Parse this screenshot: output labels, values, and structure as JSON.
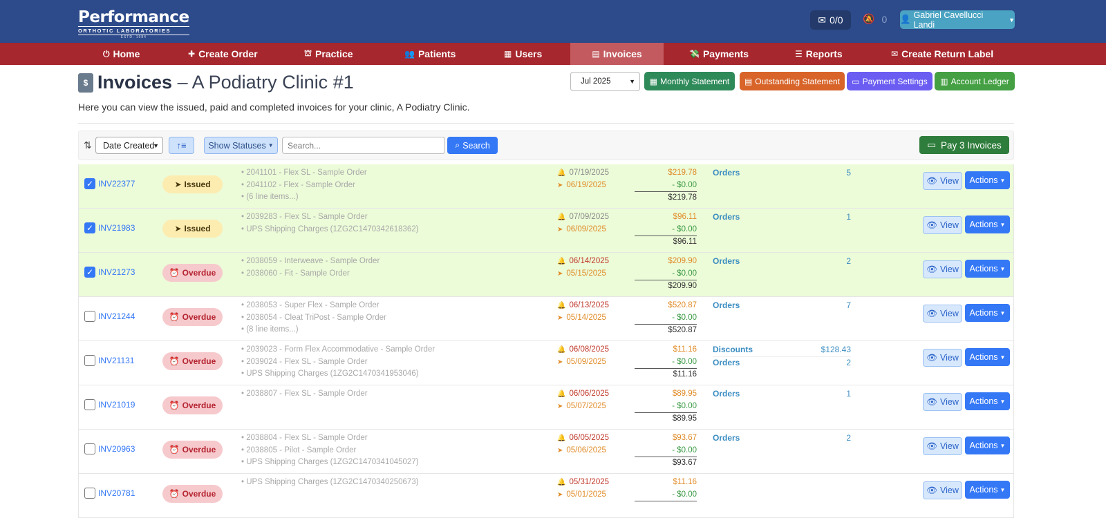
{
  "header": {
    "logo_main": "Performance",
    "logo_sub": "ORTHOTIC LABORATORIES",
    "logo_est": "ESTD. 1984",
    "messages": "0/0",
    "notifications": "0",
    "user": "Gabriel Cavellucci Landi"
  },
  "nav": [
    {
      "label": "Home",
      "icon": "⏻"
    },
    {
      "label": "Create Order",
      "icon": "✚"
    },
    {
      "label": "Practice",
      "icon": "⛫"
    },
    {
      "label": "Patients",
      "icon": "👥"
    },
    {
      "label": "Users",
      "icon": "▦"
    },
    {
      "label": "Invoices",
      "icon": "▤"
    },
    {
      "label": "Payments",
      "icon": "💸"
    },
    {
      "label": "Reports",
      "icon": "☰"
    },
    {
      "label": "Create Return Label",
      "icon": "✉"
    }
  ],
  "page": {
    "title": "Invoices",
    "subtitle": "– A Podiatry Clinic #1",
    "description": "Here you can view the issued, paid and completed invoices for your clinic, A Podiatry Clinic.",
    "month": "Jul 2025",
    "buttons": {
      "monthly": "Monthly Statement",
      "outstanding": "Outstanding Statement",
      "payment_settings": "Payment Settings",
      "ledger": "Account Ledger"
    }
  },
  "toolbar": {
    "sort_by": "Date Created",
    "show_statuses": "Show Statuses",
    "search_placeholder": "Search...",
    "search_label": "Search",
    "pay_label": "Pay 3 Invoices"
  },
  "row_labels": {
    "view": "View",
    "actions": "Actions"
  },
  "colors": {
    "primary": "#3478f6",
    "topbar": "#2d4a8a",
    "navbar": "#a6272d",
    "selected_row": "#ecfbd8"
  },
  "invoices": [
    {
      "id": "INV22377",
      "checked": true,
      "status": "Issued",
      "items": [
        "• 2041101 - Flex SL - Sample Order",
        "• 2041102 - Flex - Sample Order",
        "• (6 line items...)"
      ],
      "due": "07/19/2025",
      "sent": "06/19/2025",
      "overdue": false,
      "amount": "$219.78",
      "paid": "- $0.00",
      "balance": "$219.78",
      "cats": [
        {
          "name": "Orders",
          "value": "5"
        }
      ]
    },
    {
      "id": "INV21983",
      "checked": true,
      "status": "Issued",
      "items": [
        "• 2039283 - Flex SL - Sample Order",
        "• UPS Shipping Charges (1ZG2C1470342618362)"
      ],
      "due": "07/09/2025",
      "sent": "06/09/2025",
      "overdue": false,
      "amount": "$96.11",
      "paid": "- $0.00",
      "balance": "$96.11",
      "cats": [
        {
          "name": "Orders",
          "value": "1"
        }
      ]
    },
    {
      "id": "INV21273",
      "checked": true,
      "status": "Overdue",
      "items": [
        "• 2038059 - Interweave - Sample Order",
        "• 2038060 - Fit - Sample Order"
      ],
      "due": "06/14/2025",
      "sent": "05/15/2025",
      "overdue": true,
      "amount": "$209.90",
      "paid": "- $0.00",
      "balance": "$209.90",
      "cats": [
        {
          "name": "Orders",
          "value": "2"
        }
      ]
    },
    {
      "id": "INV21244",
      "checked": false,
      "status": "Overdue",
      "items": [
        "• 2038053 - Super Flex - Sample Order",
        "• 2038054 - Cleat TriPost - Sample Order",
        "• (8 line items...)"
      ],
      "due": "06/13/2025",
      "sent": "05/14/2025",
      "overdue": true,
      "amount": "$520.87",
      "paid": "- $0.00",
      "balance": "$520.87",
      "cats": [
        {
          "name": "Orders",
          "value": "7"
        }
      ]
    },
    {
      "id": "INV21131",
      "checked": false,
      "status": "Overdue",
      "items": [
        "• 2039023 - Form Flex Accommodative - Sample Order",
        "• 2039024 - Flex SL - Sample Order",
        "• UPS Shipping Charges (1ZG2C1470341953046)"
      ],
      "due": "06/08/2025",
      "sent": "05/09/2025",
      "overdue": true,
      "amount": "$11.16",
      "paid": "- $0.00",
      "balance": "$11.16",
      "cats": [
        {
          "name": "Discounts",
          "value": "$128.43"
        },
        {
          "name": "Orders",
          "value": "2"
        }
      ]
    },
    {
      "id": "INV21019",
      "checked": false,
      "status": "Overdue",
      "items": [
        "• 2038807 - Flex SL - Sample Order"
      ],
      "due": "06/06/2025",
      "sent": "05/07/2025",
      "overdue": true,
      "amount": "$89.95",
      "paid": "- $0.00",
      "balance": "$89.95",
      "cats": [
        {
          "name": "Orders",
          "value": "1"
        }
      ]
    },
    {
      "id": "INV20963",
      "checked": false,
      "status": "Overdue",
      "items": [
        "• 2038804 - Flex SL - Sample Order",
        "• 2038805 - Pilot - Sample Order",
        "• UPS Shipping Charges (1ZG2C1470341045027)"
      ],
      "due": "06/05/2025",
      "sent": "05/06/2025",
      "overdue": true,
      "amount": "$93.67",
      "paid": "- $0.00",
      "balance": "$93.67",
      "cats": [
        {
          "name": "Orders",
          "value": "2"
        }
      ]
    },
    {
      "id": "INV20781",
      "checked": false,
      "status": "Overdue",
      "items": [
        "• UPS Shipping Charges (1ZG2C1470340250673)"
      ],
      "due": "05/31/2025",
      "sent": "05/01/2025",
      "overdue": true,
      "amount": "$11.16",
      "paid": "- $0.00",
      "balance": "",
      "cats": []
    }
  ]
}
